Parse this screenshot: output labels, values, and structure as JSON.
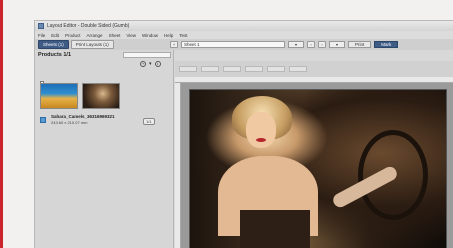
{
  "window": {
    "title": "Layout Editor - Double Sided (Gumb)"
  },
  "menu": [
    "File",
    "Edit",
    "Product",
    "Arrange",
    "Sheet",
    "View",
    "Window",
    "Help",
    "Test"
  ],
  "tabs": {
    "sheets": "Sheets (1)",
    "print_layouts": "Print Layouts (1)"
  },
  "toolbar": {
    "sheet_name": "Sheet 1",
    "print_label": "Print",
    "mark_label": "Mark"
  },
  "products": {
    "header": "Products 1/1",
    "file_name": "Sahara_Camels_36316969321",
    "file_dims": "243.60 x 210.07 mm",
    "badge": "1/1"
  },
  "colors": {
    "accent": "#3e5b86",
    "left_border": "#c9252b"
  }
}
